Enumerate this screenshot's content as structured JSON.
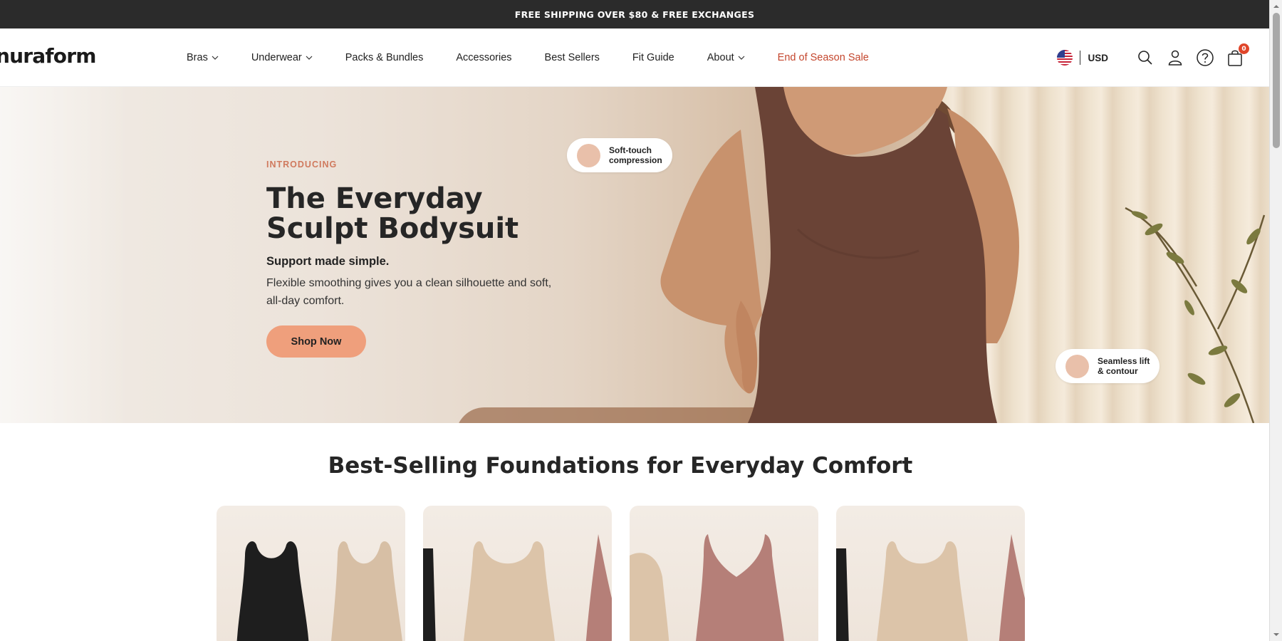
{
  "announcement": "FREE SHIPPING OVER $80 & FREE EXCHANGES",
  "brand": {
    "logo": "nuraform"
  },
  "nav": {
    "items": [
      {
        "label": "Bras",
        "dropdown": true
      },
      {
        "label": "Underwear",
        "dropdown": true
      },
      {
        "label": "Packs & Bundles",
        "dropdown": false
      },
      {
        "label": "Accessories",
        "dropdown": false
      },
      {
        "label": "Best Sellers",
        "dropdown": false
      },
      {
        "label": "Fit Guide",
        "dropdown": false
      },
      {
        "label": "About",
        "dropdown": true
      },
      {
        "label": "End of Season Sale",
        "dropdown": false,
        "highlight": "#c4462d"
      }
    ]
  },
  "header_right": {
    "currency": "USD",
    "flag_icon": "us-flag-icon",
    "icons": [
      "search-icon",
      "account-icon",
      "help-icon",
      "cart-icon"
    ],
    "cart_count": "0"
  },
  "hero": {
    "eyebrow": "INTRODUCING",
    "title_line1": "The Everyday",
    "title_line2": "Sculpt Bodysuit",
    "subtitle": "Support made simple.",
    "description": "Flexible smoothing gives you a clean silhouette and soft, all-day comfort.",
    "cta": "Shop Now",
    "callouts": [
      {
        "line1": "Soft-touch",
        "line2": "compression"
      },
      {
        "line1": "Seamless lift",
        "line2": "& contour"
      }
    ]
  },
  "section": {
    "title": "Best-Selling Foundations for Everyday Comfort",
    "product_count": 4
  },
  "colors": {
    "announcement_bg": "#2b2b2b",
    "accent": "#ef9f7c",
    "sale": "#c4462d",
    "eyebrow": "#d07a5e"
  }
}
